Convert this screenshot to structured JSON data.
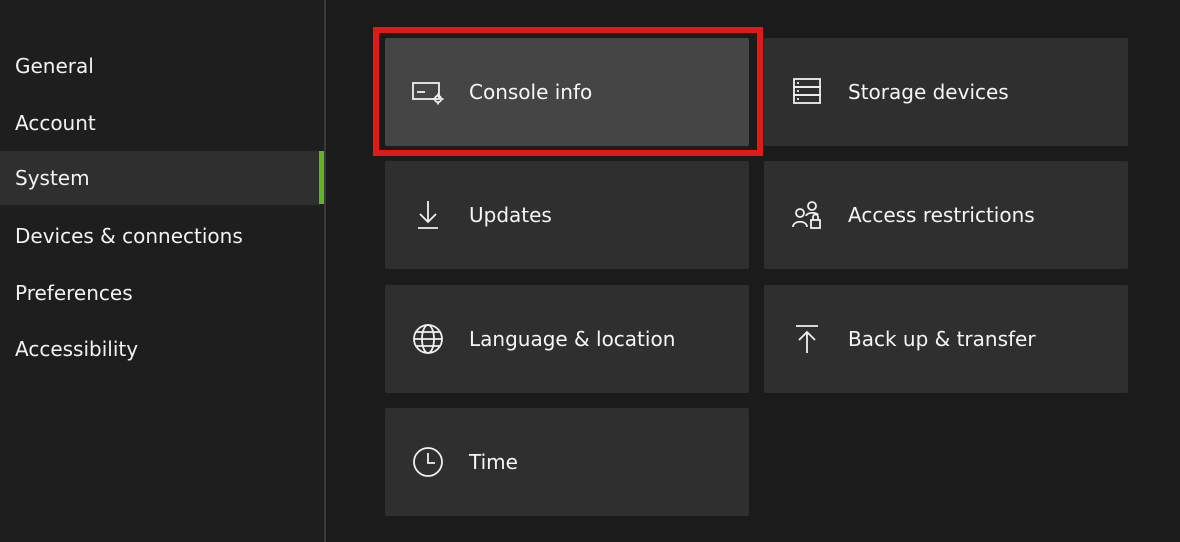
{
  "sidebar": {
    "items": [
      {
        "label": "General",
        "selected": false
      },
      {
        "label": "Account",
        "selected": false
      },
      {
        "label": "System",
        "selected": true
      },
      {
        "label": "Devices & connections",
        "selected": false
      },
      {
        "label": "Preferences",
        "selected": false
      },
      {
        "label": "Accessibility",
        "selected": false
      }
    ],
    "accent_color": "#62b522"
  },
  "tiles": [
    {
      "label": "Console info",
      "icon": "console-info-icon",
      "focused": true,
      "highlighted": true
    },
    {
      "label": "Storage devices",
      "icon": "storage-icon",
      "focused": false
    },
    {
      "label": "Updates",
      "icon": "download-arrow-icon",
      "focused": false
    },
    {
      "label": "Access restrictions",
      "icon": "people-lock-icon",
      "focused": false
    },
    {
      "label": "Language & location",
      "icon": "globe-icon",
      "focused": false
    },
    {
      "label": "Back up & transfer",
      "icon": "upload-arrow-icon",
      "focused": false
    },
    {
      "label": "Time",
      "icon": "clock-icon",
      "focused": false
    }
  ],
  "highlight_color": "#e01919"
}
